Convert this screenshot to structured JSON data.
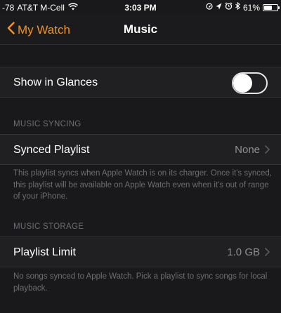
{
  "status_bar": {
    "signal": "-78",
    "carrier": "AT&T M-Cell",
    "time": "3:03 PM",
    "battery_percent": "61%",
    "battery_level": 0.61
  },
  "nav": {
    "back_label": "My Watch",
    "title": "Music"
  },
  "glances": {
    "label": "Show in Glances",
    "enabled": false
  },
  "music_syncing": {
    "header": "MUSIC SYNCING",
    "label": "Synced Playlist",
    "value": "None",
    "footer": "This playlist syncs when Apple Watch is on its charger. Once it's synced, this playlist will be available on Apple Watch even when it's out of range of your iPhone."
  },
  "music_storage": {
    "header": "MUSIC STORAGE",
    "label": "Playlist Limit",
    "value": "1.0 GB",
    "footer": "No songs synced to Apple Watch. Pick a playlist to sync songs for local playback."
  },
  "colors": {
    "accent": "#f7931e",
    "background": "#19191b",
    "cell": "#202022",
    "secondary_text": "#8e8e93"
  }
}
